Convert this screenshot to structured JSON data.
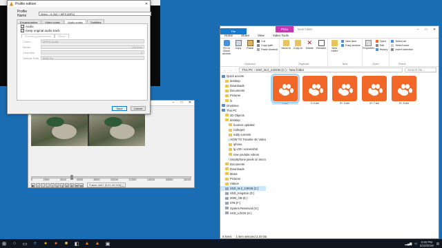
{
  "dialog": {
    "title": "Profile edition",
    "profile_label": "Profile Name",
    "profile_value": "Video - H.264 + MP3 (MP4)",
    "tabs": [
      "Encapsulation",
      "Video codec",
      "Audio codec",
      "Subtitles"
    ],
    "active_tab": "Audio codec",
    "audio_checkbox": "Audio",
    "keep_checkbox": "Keep original audio track",
    "subtabs": [
      "Encoding parameters",
      "Filters"
    ],
    "fields": [
      {
        "label": "Codec",
        "value": "MPEG Audio",
        "extra": ""
      },
      {
        "label": "Bitrate",
        "value": "",
        "extra": "128 kb/s"
      },
      {
        "label": "Channels",
        "value": "",
        "extra": "2"
      },
      {
        "label": "Sample Rate",
        "value": "8000 Hz",
        "extra": ""
      }
    ],
    "save": "Save",
    "cancel": "Cancel"
  },
  "editor": {
    "ticks": [
      "0",
      "2000",
      "4000",
      "6000",
      "8000",
      "10000",
      "12000",
      "14000",
      "16000",
      "18031"
    ],
    "frame_info": "Frame 4447 [0:01:20.943] [ ]",
    "timeline_position": 0.25
  },
  "explorer": {
    "picture_tools": "Pictu",
    "folder_title": "New folder",
    "ribbon_tabs": [
      "File",
      "Home",
      "Share",
      "View",
      "Video Tools"
    ],
    "clipboard": {
      "pin": "Pin to Quick access",
      "copy": "Copy",
      "paste": "Paste",
      "cut": "Cut",
      "copy_path": "Copy path",
      "paste_shortcut": "Paste shortcut",
      "label": "Clipboard"
    },
    "organize": {
      "move": "Move to",
      "copy": "Copy to",
      "delete": "Delete",
      "rename": "Rename",
      "label": "Organize"
    },
    "new": {
      "folder": "New folder",
      "new_item": "New item",
      "easy_access": "Easy access",
      "label": "New"
    },
    "open": {
      "properties": "Properties",
      "open": "Open",
      "edit": "Edit",
      "history": "History",
      "label": "Open"
    },
    "select": {
      "all": "Select all",
      "none": "Select none",
      "invert": "Invert selection",
      "label": "Select"
    },
    "address": [
      "This PC",
      "SSD_M.2_240GB (C:)",
      "New folder"
    ],
    "search_placeholder": "Search Ne...",
    "nav_items": [
      "Quick access",
      "desktop",
      "Downloads",
      "Documents",
      "Pictures",
      "f1",
      "OneDrive",
      "This PC",
      "3D Objects",
      "desktop",
      "boomer updated",
      "Colleges",
      "eddy currents",
      "HOW TO Transfer 4K Video",
      "iphone",
      "lg v30+ screenshot",
      "new youtube videos",
      "Smartphone pixels on micro",
      "Documents",
      "Downloads",
      "Music",
      "Pictures",
      "Videos",
      "SSD_M.2_240GB (C:)",
      "SSD_Kingston (D:)",
      "2000_GB (E:)",
      "3TB (F:)",
      "System Reserved (G:)",
      "SSD_L/SON (H:)"
    ],
    "files": [
      "1.avi",
      "2-3.avi",
      "3+-3.avi",
      "4+-7.avi",
      "5+-9.avi"
    ],
    "status_items": "6 items",
    "status_selected": "1 item selected  2.20 GB"
  },
  "taskbar": {
    "time": "3:46 PM",
    "date": "2/10/2019"
  },
  "colors": {
    "accent": "#1979ca",
    "picture_tools": "#c239b3",
    "file_thumb": "#f16728"
  }
}
